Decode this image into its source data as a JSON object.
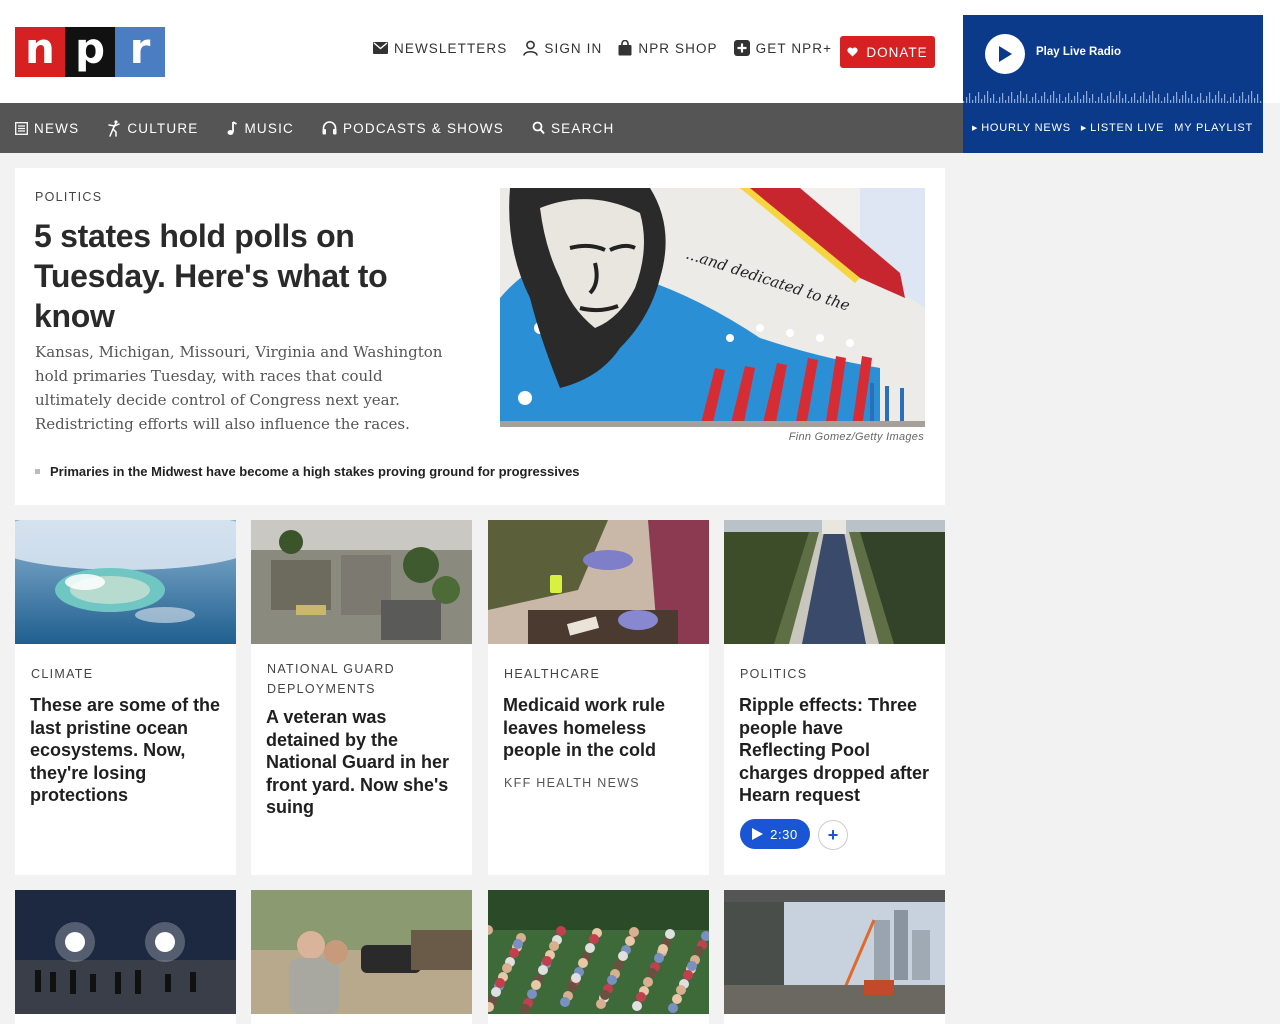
{
  "logo": {
    "letters": [
      "n",
      "p",
      "r"
    ],
    "colors": [
      "#d62021",
      "#111111",
      "#4a7dc2"
    ]
  },
  "utility": [
    {
      "label": "NEWSLETTERS",
      "icon": "envelope-icon"
    },
    {
      "label": "SIGN IN",
      "icon": "user-icon"
    },
    {
      "label": "NPR SHOP",
      "icon": "shopping-bag-icon"
    },
    {
      "label": "GET NPR+",
      "icon": "plus-square-icon"
    }
  ],
  "donate": {
    "label": "DONATE",
    "icon": "heart-icon"
  },
  "nav": [
    {
      "label": "NEWS",
      "icon": "newspaper-icon"
    },
    {
      "label": "CULTURE",
      "icon": "dancer-icon"
    },
    {
      "label": "MUSIC",
      "icon": "music-note-icon"
    },
    {
      "label": "PODCASTS & SHOWS",
      "icon": "headphones-icon"
    },
    {
      "label": "SEARCH",
      "icon": "search-icon"
    }
  ],
  "player": {
    "play_label": "Play Live Radio",
    "links": [
      "HOURLY NEWS",
      "LISTEN LIVE",
      "MY PLAYLIST"
    ],
    "bg_color": "#0b3a8a"
  },
  "feature": {
    "slug": "POLITICS",
    "title": "5 states hold polls on Tuesday. Here's what to know",
    "teaser": "Kansas, Michigan, Missouri, Virginia and Washington hold primaries Tuesday, with races that could ultimately decide control of Congress next year. Redistricting efforts will also influence the races.",
    "image_credit": "Finn Gomez/Getty Images",
    "related": "Primaries in the Midwest have become a high stakes proving ground for progressives"
  },
  "cards": [
    {
      "slug": "CLIMATE",
      "title": "These are some of the last pristine ocean ecosystems. Now, they're losing protections"
    },
    {
      "slug": "NATIONAL GUARD DEPLOYMENTS",
      "title": "A veteran was detained by the National Guard in her front yard. Now she's suing"
    },
    {
      "slug": "HEALTHCARE",
      "title": "Medicaid work rule leaves homeless people in the cold",
      "source": "KFF HEALTH NEWS"
    },
    {
      "slug": "POLITICS",
      "title": "Ripple effects: Three people have Reflecting Pool charges dropped after Hearn request",
      "audio": "2:30"
    }
  ],
  "accent_color": "#1a55d6"
}
